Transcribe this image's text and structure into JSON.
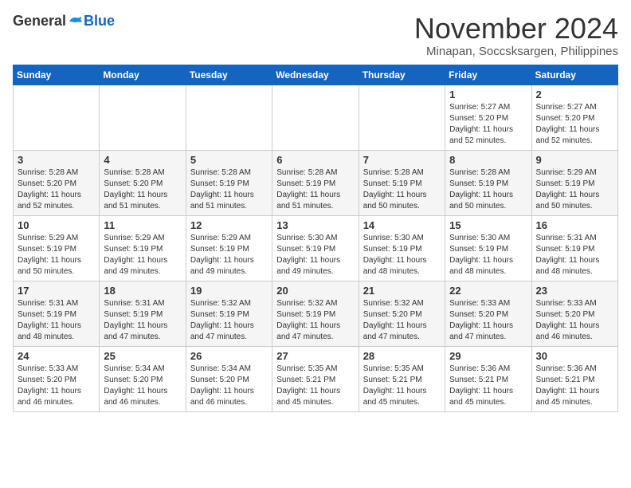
{
  "header": {
    "logo_general": "General",
    "logo_blue": "Blue",
    "month_title": "November 2024",
    "location": "Minapan, Soccsksargen, Philippines"
  },
  "days_of_week": [
    "Sunday",
    "Monday",
    "Tuesday",
    "Wednesday",
    "Thursday",
    "Friday",
    "Saturday"
  ],
  "weeks": [
    [
      {
        "day": "",
        "info": ""
      },
      {
        "day": "",
        "info": ""
      },
      {
        "day": "",
        "info": ""
      },
      {
        "day": "",
        "info": ""
      },
      {
        "day": "",
        "info": ""
      },
      {
        "day": "1",
        "info": "Sunrise: 5:27 AM\nSunset: 5:20 PM\nDaylight: 11 hours and 52 minutes."
      },
      {
        "day": "2",
        "info": "Sunrise: 5:27 AM\nSunset: 5:20 PM\nDaylight: 11 hours and 52 minutes."
      }
    ],
    [
      {
        "day": "3",
        "info": "Sunrise: 5:28 AM\nSunset: 5:20 PM\nDaylight: 11 hours and 52 minutes."
      },
      {
        "day": "4",
        "info": "Sunrise: 5:28 AM\nSunset: 5:20 PM\nDaylight: 11 hours and 51 minutes."
      },
      {
        "day": "5",
        "info": "Sunrise: 5:28 AM\nSunset: 5:19 PM\nDaylight: 11 hours and 51 minutes."
      },
      {
        "day": "6",
        "info": "Sunrise: 5:28 AM\nSunset: 5:19 PM\nDaylight: 11 hours and 51 minutes."
      },
      {
        "day": "7",
        "info": "Sunrise: 5:28 AM\nSunset: 5:19 PM\nDaylight: 11 hours and 50 minutes."
      },
      {
        "day": "8",
        "info": "Sunrise: 5:28 AM\nSunset: 5:19 PM\nDaylight: 11 hours and 50 minutes."
      },
      {
        "day": "9",
        "info": "Sunrise: 5:29 AM\nSunset: 5:19 PM\nDaylight: 11 hours and 50 minutes."
      }
    ],
    [
      {
        "day": "10",
        "info": "Sunrise: 5:29 AM\nSunset: 5:19 PM\nDaylight: 11 hours and 50 minutes."
      },
      {
        "day": "11",
        "info": "Sunrise: 5:29 AM\nSunset: 5:19 PM\nDaylight: 11 hours and 49 minutes."
      },
      {
        "day": "12",
        "info": "Sunrise: 5:29 AM\nSunset: 5:19 PM\nDaylight: 11 hours and 49 minutes."
      },
      {
        "day": "13",
        "info": "Sunrise: 5:30 AM\nSunset: 5:19 PM\nDaylight: 11 hours and 49 minutes."
      },
      {
        "day": "14",
        "info": "Sunrise: 5:30 AM\nSunset: 5:19 PM\nDaylight: 11 hours and 48 minutes."
      },
      {
        "day": "15",
        "info": "Sunrise: 5:30 AM\nSunset: 5:19 PM\nDaylight: 11 hours and 48 minutes."
      },
      {
        "day": "16",
        "info": "Sunrise: 5:31 AM\nSunset: 5:19 PM\nDaylight: 11 hours and 48 minutes."
      }
    ],
    [
      {
        "day": "17",
        "info": "Sunrise: 5:31 AM\nSunset: 5:19 PM\nDaylight: 11 hours and 48 minutes."
      },
      {
        "day": "18",
        "info": "Sunrise: 5:31 AM\nSunset: 5:19 PM\nDaylight: 11 hours and 47 minutes."
      },
      {
        "day": "19",
        "info": "Sunrise: 5:32 AM\nSunset: 5:19 PM\nDaylight: 11 hours and 47 minutes."
      },
      {
        "day": "20",
        "info": "Sunrise: 5:32 AM\nSunset: 5:19 PM\nDaylight: 11 hours and 47 minutes."
      },
      {
        "day": "21",
        "info": "Sunrise: 5:32 AM\nSunset: 5:20 PM\nDaylight: 11 hours and 47 minutes."
      },
      {
        "day": "22",
        "info": "Sunrise: 5:33 AM\nSunset: 5:20 PM\nDaylight: 11 hours and 47 minutes."
      },
      {
        "day": "23",
        "info": "Sunrise: 5:33 AM\nSunset: 5:20 PM\nDaylight: 11 hours and 46 minutes."
      }
    ],
    [
      {
        "day": "24",
        "info": "Sunrise: 5:33 AM\nSunset: 5:20 PM\nDaylight: 11 hours and 46 minutes."
      },
      {
        "day": "25",
        "info": "Sunrise: 5:34 AM\nSunset: 5:20 PM\nDaylight: 11 hours and 46 minutes."
      },
      {
        "day": "26",
        "info": "Sunrise: 5:34 AM\nSunset: 5:20 PM\nDaylight: 11 hours and 46 minutes."
      },
      {
        "day": "27",
        "info": "Sunrise: 5:35 AM\nSunset: 5:21 PM\nDaylight: 11 hours and 45 minutes."
      },
      {
        "day": "28",
        "info": "Sunrise: 5:35 AM\nSunset: 5:21 PM\nDaylight: 11 hours and 45 minutes."
      },
      {
        "day": "29",
        "info": "Sunrise: 5:36 AM\nSunset: 5:21 PM\nDaylight: 11 hours and 45 minutes."
      },
      {
        "day": "30",
        "info": "Sunrise: 5:36 AM\nSunset: 5:21 PM\nDaylight: 11 hours and 45 minutes."
      }
    ]
  ]
}
